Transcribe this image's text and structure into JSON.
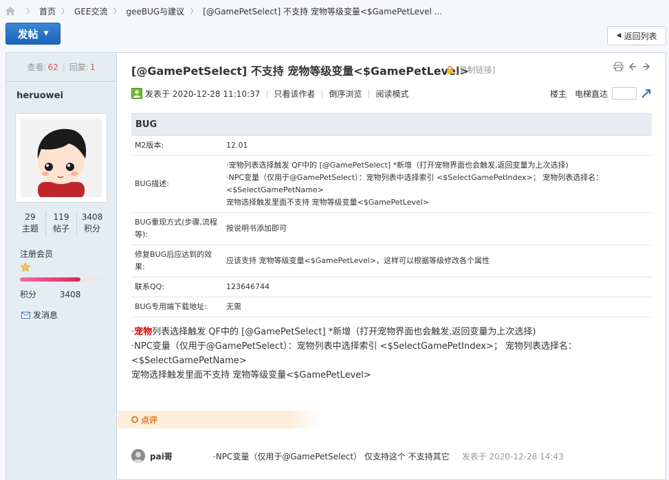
{
  "breadcrumb": {
    "items": [
      "首页",
      "GEE交流",
      "geeBUG与建议",
      "[@GamePetSelect] 不支持 宠物等级变量<$GamePetLevel ..."
    ]
  },
  "toolbar": {
    "post_label": "发帖",
    "back_label": "返回列表"
  },
  "sidebar": {
    "views_label": "查看:",
    "views": "62",
    "replies_label": "回复:",
    "replies": "1",
    "username": "heruowei",
    "counts": [
      {
        "value": "29",
        "label": "主题"
      },
      {
        "value": "119",
        "label": "帖子"
      },
      {
        "value": "3408",
        "label": "积分"
      }
    ],
    "group": "注册会员",
    "points_label": "积分",
    "points": "3408",
    "message_label": "发消息",
    "progress": 0.69
  },
  "post": {
    "title": "[@GamePetSelect] 不支持 宠物等级变量<$GamePetLevel>",
    "copy_link": "[复制链接]",
    "posted": "发表于 2020-12-28 11:10:37",
    "only_author": "只看该作者",
    "reverse": "倒序浏览",
    "read_mode": "阅读模式",
    "floor": "楼主",
    "elevator": "电梯直达",
    "table_title": "BUG",
    "rows": [
      {
        "k": "M2版本:",
        "v": [
          "12.01"
        ]
      },
      {
        "k": "BUG描述:",
        "v": [
          "·宠物列表选择触发 QF中的 [@GamePetSelect] *新增（打开宠物界面也会触发,返回变量为上次选择)",
          "·NPC变量（仅用于@GamePetSelect）：宠物列表中选择索引 <$SelectGamePetIndex>； 宠物列表选择名：",
          "<$SelectGamePetName>",
          "宠物选择触发里面不支持 宠物等级变量<$GamePetLevel>"
        ]
      },
      {
        "k": "BUG重现方式(步骤,流程等):",
        "v": [
          "按说明书添加即可"
        ]
      },
      {
        "k": "修复BUG后应达到的效果:",
        "v": [
          "应该支持 宠物等级变量<$GamePetLevel>，这样可以根据等级修改各个属性"
        ]
      },
      {
        "k": "联系QQ:",
        "v": [
          "123646744"
        ]
      },
      {
        "k": "BUG专用端下载地址:",
        "v": [
          "无需"
        ]
      }
    ],
    "body": {
      "line1_pre": "·",
      "line1_hl": "宠物",
      "line1_rest": "列表选择触发 QF中的 [@GamePetSelect]   *新增（打开宠物界面也会触发,返回变量为上次选择)",
      "line2": "·NPC变量（仅用于@GamePetSelect）：宠物列表中选择索引 <$SelectGamePetIndex>；  宠物列表选择名：",
      "line3": "<$SelectGamePetName>",
      "line4": "宠物选择触发里面不支持 宠物等级变量<$GamePetLevel>"
    }
  },
  "comments": {
    "header": "点评",
    "items": [
      {
        "user": "pai哥",
        "text": "·NPC变量（仅用于@GamePetSelect）   仅支持这个   不支持其它",
        "date": "发表于 2020-12-28 14:43"
      }
    ]
  },
  "colors": {
    "accent": "#1d63b6",
    "highlight": "#dd0000",
    "comment": "#e07b2b",
    "count_red": "#e05050"
  }
}
